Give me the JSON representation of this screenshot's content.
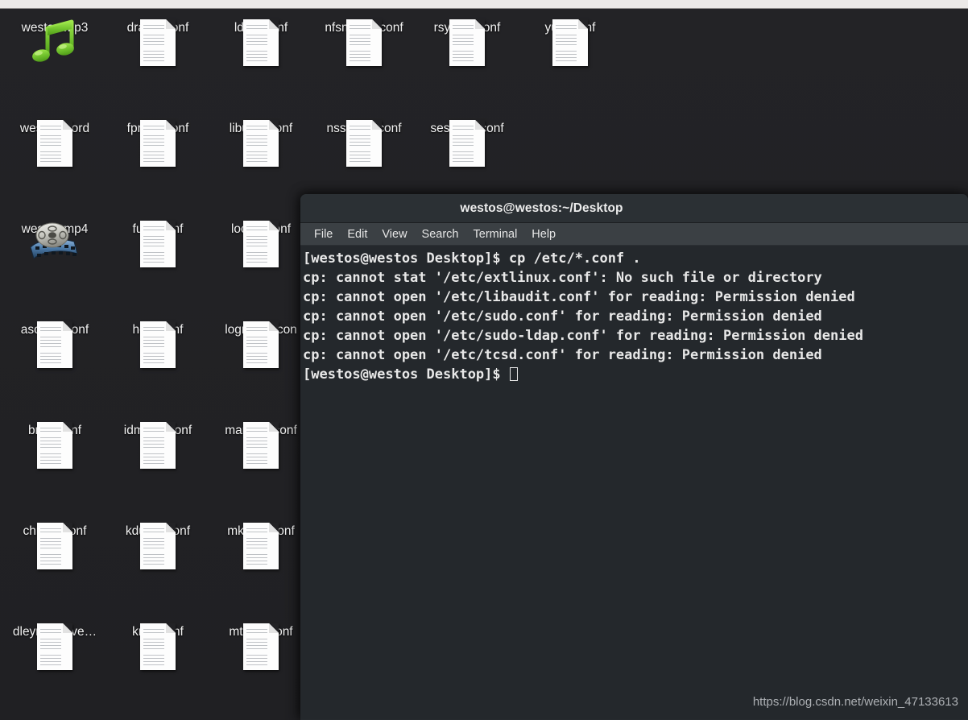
{
  "desktop": {
    "icons": [
      {
        "label": "westos.mp3",
        "type": "audio",
        "col": 0,
        "row": 0
      },
      {
        "label": "dracut.conf",
        "type": "document",
        "col": 1,
        "row": 0
      },
      {
        "label": "ld.so.conf",
        "type": "document",
        "col": 2,
        "row": 0
      },
      {
        "label": "nfsmount.conf",
        "type": "document",
        "col": 3,
        "row": 0
      },
      {
        "label": "rsyslog.conf",
        "type": "document",
        "col": 4,
        "row": 0
      },
      {
        "label": "yum.conf",
        "type": "document",
        "col": 5,
        "row": 0
      },
      {
        "label": "westos.word",
        "type": "document",
        "col": 0,
        "row": 1
      },
      {
        "label": "fprintd.conf",
        "type": "document",
        "col": 1,
        "row": 1
      },
      {
        "label": "libuser.conf",
        "type": "document",
        "col": 2,
        "row": 1
      },
      {
        "label": "nsswitch.conf",
        "type": "document",
        "col": 3,
        "row": 1
      },
      {
        "label": "sestatus.conf",
        "type": "document",
        "col": 4,
        "row": 1
      },
      {
        "label": "westos.mp4",
        "type": "video",
        "col": 0,
        "row": 2
      },
      {
        "label": "fuse.conf",
        "type": "document",
        "col": 1,
        "row": 2
      },
      {
        "label": "locale.conf",
        "type": "document",
        "col": 2,
        "row": 2
      },
      {
        "label": "asound.conf",
        "type": "document",
        "col": 0,
        "row": 3
      },
      {
        "label": "host.conf",
        "type": "document",
        "col": 1,
        "row": 3
      },
      {
        "label": "logrotate.con",
        "type": "document",
        "col": 2,
        "row": 3
      },
      {
        "label": "brltty.conf",
        "type": "document",
        "col": 0,
        "row": 4
      },
      {
        "label": "idmapd.conf",
        "type": "document",
        "col": 1,
        "row": 4
      },
      {
        "label": "man_db.conf",
        "type": "document",
        "col": 2,
        "row": 4
      },
      {
        "label": "chrony.conf",
        "type": "document",
        "col": 0,
        "row": 5
      },
      {
        "label": "kdump.conf",
        "type": "document",
        "col": 1,
        "row": 5
      },
      {
        "label": "mke2fs.conf",
        "type": "document",
        "col": 2,
        "row": 5
      },
      {
        "label": "dleyna-serve…",
        "type": "document",
        "col": 0,
        "row": 6
      },
      {
        "label": "krb5.conf",
        "type": "document",
        "col": 1,
        "row": 6
      },
      {
        "label": "mtools.conf",
        "type": "document",
        "col": 2,
        "row": 6
      }
    ]
  },
  "terminal": {
    "title": "westos@westos:~/Desktop",
    "menu": [
      "File",
      "Edit",
      "View",
      "Search",
      "Terminal",
      "Help"
    ],
    "lines": [
      "[westos@westos Desktop]$ cp /etc/*.conf .",
      "cp: cannot stat '/etc/extlinux.conf': No such file or directory",
      "cp: cannot open '/etc/libaudit.conf' for reading: Permission denied",
      "cp: cannot open '/etc/sudo.conf' for reading: Permission denied",
      "cp: cannot open '/etc/sudo-ldap.conf' for reading: Permission denied",
      "cp: cannot open '/etc/tcsd.conf' for reading: Permission denied"
    ],
    "prompt": "[westos@westos Desktop]$ "
  },
  "watermark": {
    "text": "https://blog.csdn.net/weixin_47133613"
  },
  "colors": {
    "desktop_bg": "#222225",
    "panel_bg": "#ebe9e7",
    "term_bg": "#24282c",
    "titlebar_bg": "#2b3034",
    "menubar_bg": "#3b4044",
    "term_text": "#e8e8e8",
    "audio_icon": "#6fc02c"
  }
}
